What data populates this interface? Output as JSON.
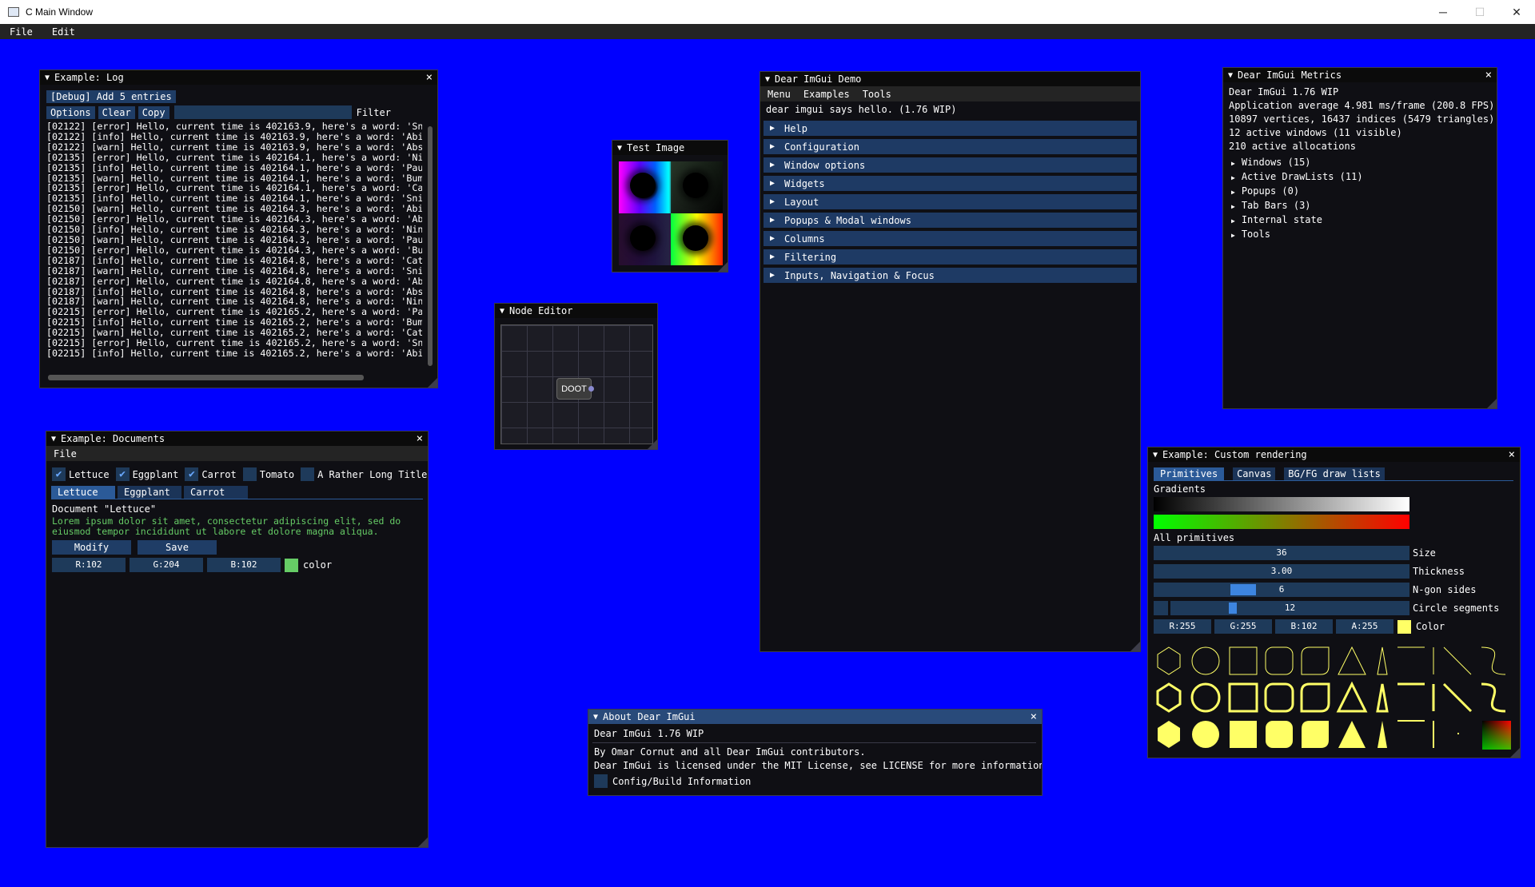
{
  "os": {
    "title": "C Main Window",
    "minimize": "─",
    "maximize": "☐",
    "close": "✕"
  },
  "menubar": {
    "file": "File",
    "edit": "Edit"
  },
  "log": {
    "title": "Example: Log",
    "debug_btn": "[Debug] Add 5 entries",
    "options": "Options",
    "clear": "Clear",
    "copy": "Copy",
    "filter_label": "Filter",
    "lines": [
      "[02122] [error] Hello, current time is 402163.9, here's a word: 'Sn",
      "[02122] [info] Hello, current time is 402163.9, here's a word: 'Abi",
      "[02122] [warn] Hello, current time is 402163.9, here's a word: 'Abs",
      "[02135] [error] Hello, current time is 402164.1, here's a word: 'Ni",
      "[02135] [info] Hello, current time is 402164.1, here's a word: 'Pau",
      "[02135] [warn] Hello, current time is 402164.1, here's a word: 'Bum",
      "[02135] [error] Hello, current time is 402164.1, here's a word: 'Ca",
      "[02135] [info] Hello, current time is 402164.1, here's a word: 'Sni",
      "[02150] [warn] Hello, current time is 402164.3, here's a word: 'Abi",
      "[02150] [error] Hello, current time is 402164.3, here's a word: 'Ab",
      "[02150] [info] Hello, current time is 402164.3, here's a word: 'Nin",
      "[02150] [warn] Hello, current time is 402164.3, here's a word: 'Pau",
      "[02150] [error] Hello, current time is 402164.3, here's a word: 'Bu",
      "[02187] [info] Hello, current time is 402164.8, here's a word: 'Cat",
      "[02187] [warn] Hello, current time is 402164.8, here's a word: 'Sni",
      "[02187] [error] Hello, current time is 402164.8, here's a word: 'Ab",
      "[02187] [info] Hello, current time is 402164.8, here's a word: 'Abs",
      "[02187] [warn] Hello, current time is 402164.8, here's a word: 'Nin",
      "[02215] [error] Hello, current time is 402165.2, here's a word: 'Pa",
      "[02215] [info] Hello, current time is 402165.2, here's a word: 'Bum",
      "[02215] [warn] Hello, current time is 402165.2, here's a word: 'Cat",
      "[02215] [error] Hello, current time is 402165.2, here's a word: 'Sn",
      "[02215] [info] Hello, current time is 402165.2, here's a word: 'Abi"
    ]
  },
  "test_image": {
    "title": "Test Image"
  },
  "node_editor": {
    "title": "Node Editor",
    "node_label": "DOOT"
  },
  "demo": {
    "title": "Dear ImGui Demo",
    "menu": [
      "Menu",
      "Examples",
      "Tools"
    ],
    "hello": "dear imgui says hello. (1.76 WIP)",
    "headers": [
      "Help",
      "Configuration",
      "Window options",
      "Widgets",
      "Layout",
      "Popups & Modal windows",
      "Columns",
      "Filtering",
      "Inputs, Navigation & Focus"
    ]
  },
  "metrics": {
    "title": "Dear ImGui Metrics",
    "lines": [
      "Dear ImGui 1.76 WIP",
      "Application average 4.981 ms/frame (200.8 FPS)",
      "10897 vertices, 16437 indices (5479 triangles)",
      "12 active windows (11 visible)",
      "210 active allocations"
    ],
    "tree": [
      "Windows (15)",
      "Active DrawLists (11)",
      "Popups (0)",
      "Tab Bars (3)",
      "Internal state",
      "Tools"
    ]
  },
  "documents": {
    "title": "Example: Documents",
    "menu_file": "File",
    "checkboxes": [
      {
        "label": "Lettuce",
        "checked": "✔"
      },
      {
        "label": "Eggplant",
        "checked": "✔"
      },
      {
        "label": "Carrot",
        "checked": "✔"
      },
      {
        "label": "Tomato",
        "checked": ""
      },
      {
        "label": "A Rather Long Title",
        "checked": ""
      }
    ],
    "tabs": [
      "Lettuce",
      "Eggplant",
      "Carrot"
    ],
    "doc_title": "Document \"Lettuce\"",
    "lorem1": "Lorem ipsum dolor sit amet, consectetur adipiscing elit, sed do",
    "lorem2": "eiusmod tempor incididunt ut labore et dolore magna aliqua.",
    "modify": "Modify",
    "save": "Save",
    "r": "R:102",
    "g": "G:204",
    "b": "B:102",
    "color_label": "color",
    "color_hex": "#66cc66"
  },
  "custom": {
    "title": "Example: Custom rendering",
    "tabs": [
      "Primitives",
      "Canvas",
      "BG/FG draw lists"
    ],
    "gradients": "Gradients",
    "all_primitives": "All primitives",
    "size_val": "36",
    "size_label": "Size",
    "thick_val": "3.00",
    "thick_label": "Thickness",
    "ngon_val": "6",
    "ngon_label": "N-gon sides",
    "circle_val": "12",
    "circle_label": "Circle segments",
    "r": "R:255",
    "g": "G:255",
    "b": "B:102",
    "a": "A:255",
    "color_label": "Color",
    "color_hex": "#ffff66"
  },
  "about": {
    "title": "About Dear ImGui",
    "version": "Dear ImGui 1.76 WIP",
    "by": "By Omar Cornut and all Dear ImGui contributors.",
    "license": "Dear ImGui is licensed under the MIT License, see LICENSE for more information.",
    "config": "Config/Build Information"
  }
}
